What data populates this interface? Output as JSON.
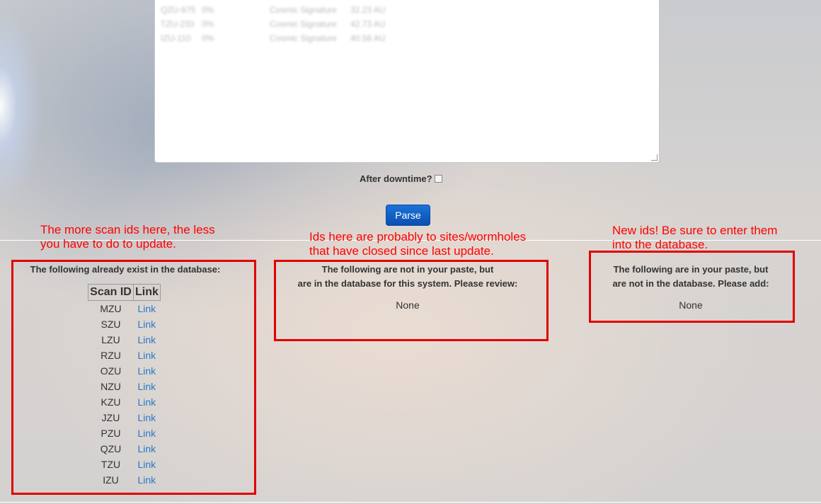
{
  "paste": {
    "rows": [
      {
        "id": "QZU-675",
        "pct": "0%",
        "type": "Cosmic Signature",
        "dist": "32.23 AU"
      },
      {
        "id": "TZU-233",
        "pct": "0%",
        "type": "Cosmic Signature",
        "dist": "42.73 AU"
      },
      {
        "id": "IZU-110",
        "pct": "0%",
        "type": "Cosmic Signature",
        "dist": "40.56 AU"
      }
    ]
  },
  "downtime": {
    "label": "After downtime?"
  },
  "parse_button": {
    "label": "Parse"
  },
  "annotations": {
    "left": [
      "The more scan ids here, the less",
      "you have to do to update."
    ],
    "middle": [
      "Ids here are probably to sites/wormholes",
      "that have closed since last update."
    ],
    "right": [
      "New ids! Be sure to enter them",
      "into the database."
    ]
  },
  "existing": {
    "title": "The following already exist in the database:",
    "headers": [
      "Scan ID",
      "Link"
    ],
    "rows": [
      {
        "id": "MZU",
        "link": "Link"
      },
      {
        "id": "SZU",
        "link": "Link"
      },
      {
        "id": "LZU",
        "link": "Link"
      },
      {
        "id": "RZU",
        "link": "Link"
      },
      {
        "id": "OZU",
        "link": "Link"
      },
      {
        "id": "NZU",
        "link": "Link"
      },
      {
        "id": "KZU",
        "link": "Link"
      },
      {
        "id": "JZU",
        "link": "Link"
      },
      {
        "id": "PZU",
        "link": "Link"
      },
      {
        "id": "QZU",
        "link": "Link"
      },
      {
        "id": "TZU",
        "link": "Link"
      },
      {
        "id": "IZU",
        "link": "Link"
      }
    ]
  },
  "missing": {
    "title_lines": [
      "The following are not in your paste, but",
      "are in the database for this system. Please review:"
    ],
    "value": "None"
  },
  "new_ids": {
    "title_lines": [
      "The following are in your paste, but",
      "are not in the database. Please add:"
    ],
    "value": "None"
  }
}
